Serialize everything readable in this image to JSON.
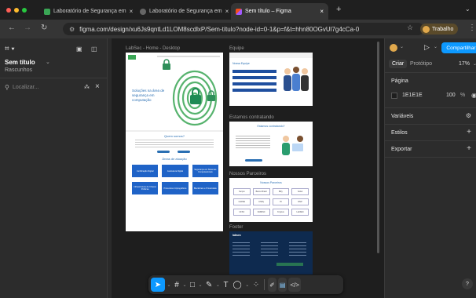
{
  "browser": {
    "tabs": [
      {
        "title": "Laboratório de Segurança em",
        "color": "#3aa655"
      },
      {
        "title": "Laboratório de Segurança em",
        "color": "#888888"
      },
      {
        "title": "Sem título – Figma",
        "color": "#f24e1e"
      }
    ],
    "url": "figma.com/design/xu6Js9qntLd1LOM8scdlxP/Sem-título?node-id=0-1&p=f&t=hhn80OGvUl7g4cCa-0",
    "profile_label": "Trabalho"
  },
  "left_panel": {
    "file_name": "Sem título",
    "file_subtitle": "Rascunhos",
    "search_placeholder": "Localizar..."
  },
  "canvas": {
    "frame_labels": {
      "labsec": "LabSec - Home - Desktop",
      "equipe": "Equipe",
      "contratando": "Estamos contratando",
      "parceiros": "Nossos Parceiros",
      "footer": "Footer"
    },
    "labsec": {
      "hero_text": "Soluções na área de segurança em computação",
      "quem_somos": "Quem somos?",
      "areas_title": "Áreas de atuação",
      "areas": [
        "Certificação Digital",
        "Assinatura Digital",
        "Segurança em Sistemas Computacionais",
        "Infraestrutura de Chaves Públicas",
        "Protocolos Criptográficos",
        "Blockchain e Privacidade"
      ]
    },
    "equipe": {
      "title": "Nossa Equipe"
    },
    "contratando": {
      "title": "Estamos contratando?"
    },
    "parceiros": {
      "title": "Nossos Parceiros",
      "logos": [
        "Serpro",
        "Banco Brasil",
        "BRy",
        "Soluti",
        "CAPES",
        "CNPq",
        "ITI",
        "RNP",
        "UFSC",
        "FAPESC",
        "Kryptus",
        "LabSEC"
      ]
    },
    "footer": {
      "brand": "labsec"
    }
  },
  "right_panel": {
    "tabs": [
      "Criar",
      "Protótipo"
    ],
    "zoom": "17%",
    "share_label": "Compartilhar",
    "page_section": "Página",
    "page_color": "1E1E1E",
    "page_opacity": "100",
    "page_opacity_unit": "%",
    "sections": [
      "Variáveis",
      "Estilos",
      "Exportar"
    ],
    "help": "?"
  }
}
